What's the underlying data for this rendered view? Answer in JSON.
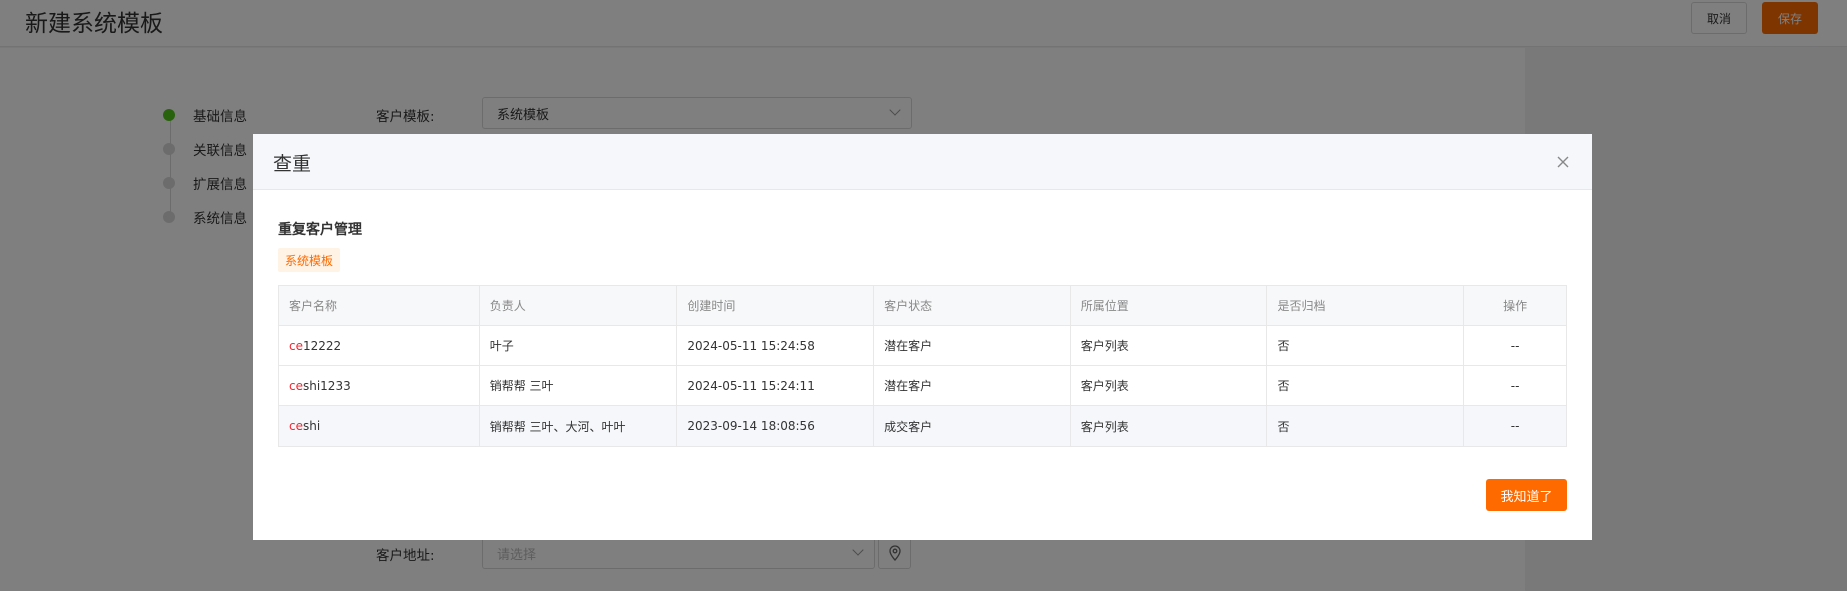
{
  "page": {
    "title": "新建系统模板",
    "cancel_label": "取消",
    "save_label": "保存"
  },
  "steps": [
    {
      "label": "基础信息",
      "active": true
    },
    {
      "label": "关联信息",
      "active": false
    },
    {
      "label": "扩展信息",
      "active": false
    },
    {
      "label": "系统信息",
      "active": false
    }
  ],
  "form": {
    "template_label": "客户模板:",
    "template_value": "系统模板",
    "address_label": "客户地址:",
    "address_placeholder": "请选择"
  },
  "modal": {
    "title": "查重",
    "section_title": "重复客户管理",
    "tag": "系统模板",
    "ok_label": "我知道了",
    "columns": [
      "客户名称",
      "负责人",
      "创建时间",
      "客户状态",
      "所属位置",
      "是否归档",
      "操作"
    ],
    "rows": [
      {
        "name_hl": "ce",
        "name_rest": "12222",
        "owner": "叶子",
        "created": "2024-05-11 15:24:58",
        "status": "潜在客户",
        "location": "客户列表",
        "archived": "否",
        "action": "--"
      },
      {
        "name_hl": "ce",
        "name_rest": "shi1233",
        "owner": "销帮帮 三叶",
        "created": "2024-05-11 15:24:11",
        "status": "潜在客户",
        "location": "客户列表",
        "archived": "否",
        "action": "--"
      },
      {
        "name_hl": "ce",
        "name_rest": "shi",
        "owner": "销帮帮 三叶、大河、叶叶",
        "created": "2023-09-14 18:08:56",
        "status": "成交客户",
        "location": "客户列表",
        "archived": "否",
        "action": "--"
      }
    ]
  },
  "colors": {
    "accent": "#ff6a00",
    "highlight": "#f5222d",
    "step_active": "#52c41a"
  }
}
